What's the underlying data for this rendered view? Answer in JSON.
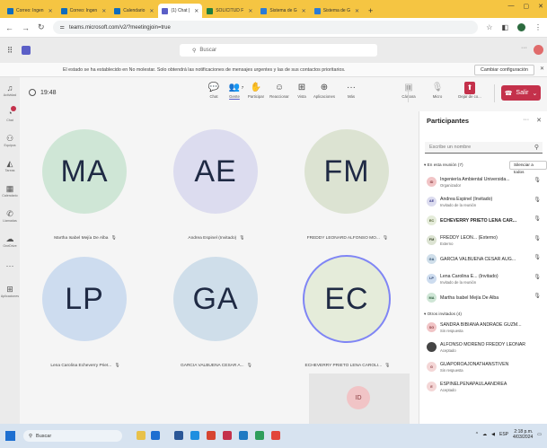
{
  "browser": {
    "tabs": [
      {
        "label": "Correo: Ingen",
        "color": "#0f6cbd",
        "active": false
      },
      {
        "label": "Correo: Ingen",
        "color": "#0f6cbd",
        "active": false
      },
      {
        "label": "Calendario",
        "color": "#0f6cbd",
        "active": false
      },
      {
        "label": "(1) Chat |",
        "color": "#5b5fc7",
        "active": true
      },
      {
        "label": "SOLICITUD F",
        "color": "#1e7e3e",
        "active": false
      },
      {
        "label": "Sistema de G",
        "color": "#2b7bd6",
        "active": false
      },
      {
        "label": "Sistema de G",
        "color": "#2b7bd6",
        "active": false
      }
    ],
    "new_tab": "+",
    "url": "teams.microsoft.com/v2/?meetingjoin=true"
  },
  "teams": {
    "search_placeholder": "Buscar",
    "more": "···"
  },
  "notice": {
    "message": "El estado se ha establecido en No molestar. Solo obtendrá las notificaciones de mensajes urgentes y las de sus contactos prioritarios.",
    "button": "Cambiar configuración",
    "close": "✕"
  },
  "rail": [
    {
      "icon": "bell-icon",
      "glyph": "♫",
      "label": "Actividad",
      "badge": false
    },
    {
      "icon": "chat-icon",
      "glyph": "◔",
      "label": "Chat",
      "badge": true
    },
    {
      "icon": "teams-icon",
      "glyph": "⚇",
      "label": "Equipos",
      "badge": false
    },
    {
      "icon": "bell-outline-icon",
      "glyph": "◭",
      "label": "Tareas",
      "badge": false
    },
    {
      "icon": "calendar-icon",
      "glyph": "▦",
      "label": "Calendario",
      "badge": false
    },
    {
      "icon": "calls-icon",
      "glyph": "✆",
      "label": "Llamadas",
      "badge": false
    },
    {
      "icon": "onedrive-icon",
      "glyph": "☁",
      "label": "OneDrive",
      "badge": false
    },
    {
      "icon": "more-icon",
      "glyph": "···",
      "label": "",
      "badge": false
    },
    {
      "icon": "apps-icon",
      "glyph": "⊞",
      "label": "Aplicaciones",
      "badge": false
    }
  ],
  "meeting": {
    "timer": "19:48",
    "toolbar": [
      {
        "name": "chat",
        "glyph": "💬",
        "label": "Chat",
        "count": "",
        "active": false
      },
      {
        "name": "participants",
        "glyph": "👥",
        "label": "Gente",
        "count": "7",
        "active": true
      },
      {
        "name": "raise-hand",
        "glyph": "✋",
        "label": "Participar",
        "count": "",
        "active": false
      },
      {
        "name": "react",
        "glyph": "☺",
        "label": "Reaccionar",
        "count": "",
        "active": false
      },
      {
        "name": "view",
        "glyph": "⊞",
        "label": "Vista",
        "count": "",
        "active": false
      },
      {
        "name": "apps",
        "glyph": "⊕",
        "label": "Aplicaciones",
        "count": "",
        "active": false
      },
      {
        "name": "more",
        "glyph": "···",
        "label": "Más",
        "count": "",
        "active": false
      },
      {
        "name": "camera",
        "glyph": "▣",
        "label": "Cámara",
        "count": "",
        "active": false
      },
      {
        "name": "mic",
        "glyph": "🎙",
        "label": "Micro",
        "count": "",
        "active": false
      },
      {
        "name": "share",
        "glyph": "⬆",
        "label": "Dejar de co...",
        "count": "",
        "active": false
      }
    ],
    "leave": "Salir"
  },
  "tiles": [
    {
      "initials": "MA",
      "name": "Martha Isabel Mejía De Alba",
      "color": "#cfe6d6",
      "speaking": false
    },
    {
      "initials": "AE",
      "name": "Andrea Espinel (Invitado)",
      "color": "#dcdcef",
      "speaking": false
    },
    {
      "initials": "FM",
      "name": "FREDDY LEONARD ALFONSO MO...",
      "color": "#dce3d2",
      "speaking": false
    },
    {
      "initials": "LP",
      "name": "Lena Carolina Echeverry Priet...",
      "color": "#cddcef",
      "speaking": false
    },
    {
      "initials": "GA",
      "name": "GARCIA VALBUENA CESAR A...",
      "color": "#cfdeea",
      "speaking": false
    },
    {
      "initials": "EC",
      "name": "ECHEVERRY PRIETO LENA CAROLI...",
      "color": "#e5ecda",
      "speaking": true
    }
  ],
  "self_tile": {
    "initials": "ID"
  },
  "panel": {
    "title": "Participantes",
    "search_placeholder": "Escribe un nombre",
    "in_meeting_title": "▾ En esta reunión (7)",
    "mute_all": "Silenciar a todos",
    "in_meeting": [
      {
        "initials": "ID",
        "name": "Ingeniería Ambiental Universida...",
        "sub": "Organizador",
        "color": "#f1c4c6",
        "text": "#8a3a3e",
        "bold": false
      },
      {
        "initials": "AE",
        "name": "Andrea Espinel (Invitado)",
        "sub": "Invitado de la reunión",
        "color": "#dcdcef",
        "text": "#3b3b8a",
        "bold": false
      },
      {
        "initials": "EC",
        "name": "ECHEVERRY PRIETO LENA CAR...",
        "sub": "",
        "color": "#e5ecda",
        "text": "#4a5a2a",
        "bold": true
      },
      {
        "initials": "FM",
        "name": "FREDDY LEON... (Externo)",
        "sub": "Externo",
        "color": "#dce3d2",
        "text": "#3e4a30",
        "bold": false
      },
      {
        "initials": "GA",
        "name": "GARCIA VALBUENA CESAR AUG...",
        "sub": "",
        "color": "#cfdeea",
        "text": "#2a4a6a",
        "bold": false
      },
      {
        "initials": "LP",
        "name": "Lena Carolina E... (Invitado)",
        "sub": "Invitado de la reunión",
        "color": "#cddcef",
        "text": "#2a3f6a",
        "bold": false
      },
      {
        "initials": "MA",
        "name": "Martha Isabel Mejía De Alba",
        "sub": "",
        "color": "#cfe6d6",
        "text": "#2a5a3a",
        "bold": false
      }
    ],
    "others_title": "▾ Otros invitados (4)",
    "others": [
      {
        "initials": "SG",
        "name": "SANDRA BIBIANA ANDRADE GUZM...",
        "sub": "Sin respuesta",
        "color": "#f1c4c6",
        "text": "#8a3a3e"
      },
      {
        "initials": "",
        "name": "ALFONSO MORENO FREDDY LEONAR",
        "sub": "Aceptado",
        "color": "#444444",
        "text": "#ffffff"
      },
      {
        "initials": "G",
        "name": "GUAPOROAJONATHANSTIVEN",
        "sub": "Sin respuesta",
        "color": "#f4d6d6",
        "text": "#8a3a3e"
      },
      {
        "initials": "E",
        "name": "ESPINELPENAPAULAANDREA",
        "sub": "Aceptado",
        "color": "#f4d6d6",
        "text": "#8a3a3e"
      }
    ]
  },
  "taskbar": {
    "search": "Buscar",
    "time": "2:18 p.m.",
    "date": "4/03/2024",
    "lang": "ESP"
  }
}
